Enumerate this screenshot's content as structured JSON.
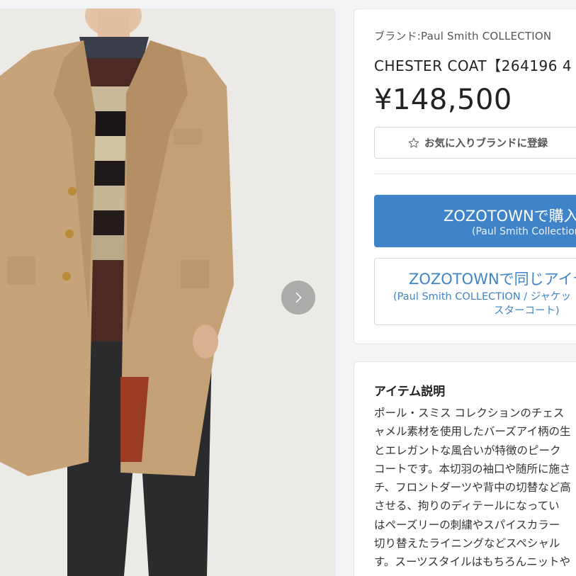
{
  "image_gallery": {
    "photo_alt": "Paul Smith COLLECTION CHESTER COAT",
    "next_icon": "chevron-right-icon"
  },
  "product": {
    "brand_line": "ブランド:Paul Smith COLLECTION",
    "name": "CHESTER COAT【264196 4",
    "price": "¥148,500",
    "favorite_label": "お気に入りブランドに登録",
    "favorite_icon": "star-outline-icon",
    "buy_main": "ZOZOTOWNで購入",
    "buy_sub": "(Paul Smith Collection",
    "same_main": "ZOZOTOWNで同じアイテ",
    "same_sub_line1": "(Paul Smith COLLECTION / ジャケッ",
    "same_sub_line2": "スターコート)"
  },
  "description": {
    "title": "アイテム説明",
    "lines": [
      "ポール・スミス コレクションのチェス",
      "ャメル素材を使用したバーズアイ柄の生",
      "とエレガントな風合いが特徴のピーク",
      "コートです。本切羽の袖口や随所に施さ",
      "チ、フロントダーツや背中の切替など高",
      "させる、拘りのディテールになってい",
      "はペーズリーの刺繍やスパイスカラー",
      "切り替えたライニングなどスペシャル",
      "す。スーツスタイルはもちろんニットや"
    ]
  },
  "colors": {
    "accent_blue": "#3f84c9",
    "background": "#f3f4f6",
    "card": "#ffffff"
  }
}
